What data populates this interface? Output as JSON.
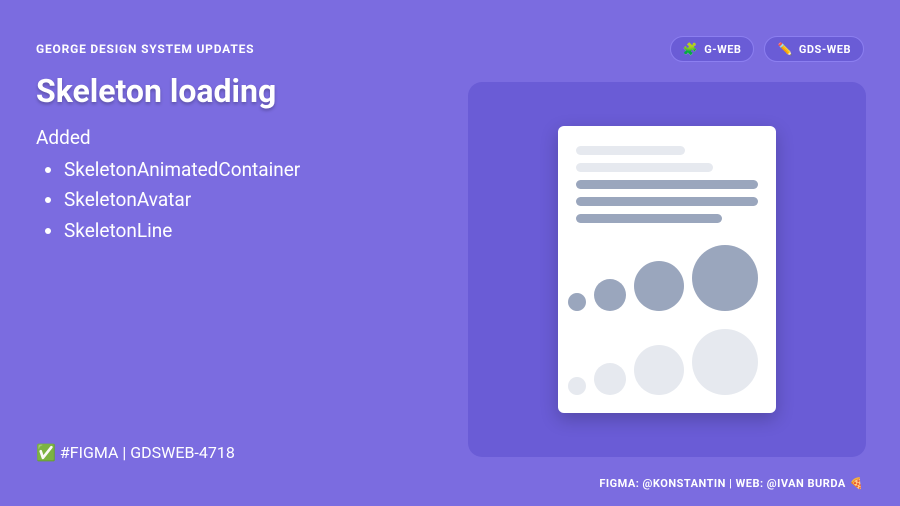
{
  "kicker": "GEORGE DESIGN SYSTEM UPDATES",
  "pills": {
    "gweb": {
      "icon": "🧩",
      "label": "G-WEB"
    },
    "gdsweb": {
      "icon": "✏️",
      "label": "GDS-WEB"
    }
  },
  "title": "Skeleton loading",
  "section_label": "Added",
  "items": [
    "SkeletonAnimatedContainer",
    "SkeletonAvatar",
    "SkeletonLine"
  ],
  "footer_left": {
    "icon": "✅",
    "text": "#FIGMA | GDSWEB-4718"
  },
  "footer_right": {
    "text": "FIGMA: @KONSTANTIN | WEB: @IVAN BURDA",
    "icon": "🍕"
  }
}
